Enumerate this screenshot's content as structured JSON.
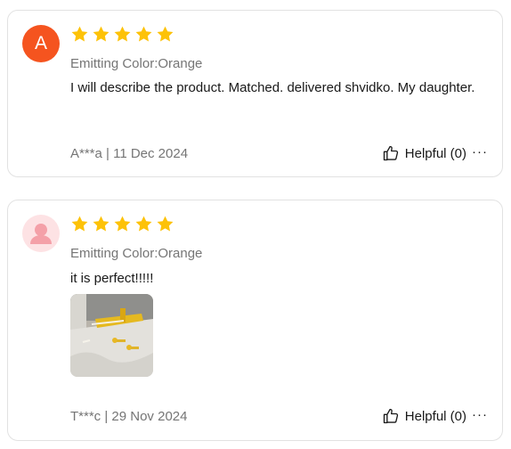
{
  "reviews": [
    {
      "avatar_letter": "A",
      "avatar_color": "#f5541f",
      "rating": 5,
      "variant": "Emitting Color:Orange",
      "text": "I will describe the product. Matched. delivered shvidko. My daughter.",
      "meta": "A***a | 11 Dec 2024",
      "helpful_label": "Helpful (0)",
      "more_label": "···"
    },
    {
      "avatar_letter": "",
      "rating": 5,
      "variant": "Emitting Color:Orange",
      "text": "it is perfect!!!!!",
      "meta": "T***c | 29 Nov 2024",
      "helpful_label": "Helpful (0)",
      "more_label": "···"
    }
  ],
  "colors": {
    "star": "#fdc208",
    "muted": "#757575",
    "border": "#e2e2e2"
  },
  "icons": [
    "star-icon",
    "thumbs-up-icon",
    "more-icon",
    "default-avatar-icon"
  ]
}
